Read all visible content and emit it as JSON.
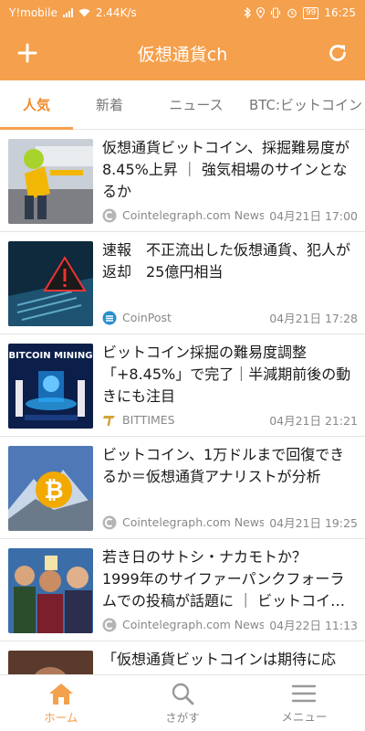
{
  "status_bar": {
    "carrier": "Y!mobile",
    "speed": "2.44K/s",
    "battery": "99",
    "time": "16:25"
  },
  "app_bar": {
    "title": "仮想通貨ch",
    "left_icon": "plus-icon",
    "right_icon": "refresh-icon"
  },
  "tabs": [
    {
      "label": "人気",
      "active": true
    },
    {
      "label": "新着",
      "active": false
    },
    {
      "label": "ニュース",
      "active": false
    },
    {
      "label": "BTC:ビットコイン",
      "active": false
    }
  ],
  "articles": [
    {
      "title": "仮想通貨ビットコイン、採掘難易度が8.45%上昇 ｜ 強気相場のサインとなるか",
      "source": "Cointelegraph.com News",
      "date": "04月21日 17:00",
      "source_icon": "cointelegraph-icon"
    },
    {
      "title": "速報　不正流出した仮想通貨、犯人が返却　25億円相当",
      "source": "CoinPost",
      "date": "04月21日 17:28",
      "source_icon": "coinpost-icon"
    },
    {
      "title": "ビットコイン採掘の難易度調整「+8.45%」で完了｜半減期前後の動きにも注目",
      "source": "BITTIMES",
      "date": "04月21日 21:21",
      "source_icon": "bittimes-icon",
      "thumb_text": "BITCOIN MINING"
    },
    {
      "title": "ビットコイン、1万ドルまで回復できるか＝仮想通貨アナリストが分析",
      "source": "Cointelegraph.com News",
      "date": "04月21日 19:25",
      "source_icon": "cointelegraph-icon"
    },
    {
      "title": "若き日のサトシ・ナカモトか？　1999年のサイファーパンクフォーラムでの投稿が話題に ｜ ビットコイ…",
      "source": "Cointelegraph.com News",
      "date": "04月22日 11:13",
      "source_icon": "cointelegraph-icon"
    },
    {
      "title": "「仮想通貨ビットコインは期待に応",
      "source": "",
      "date": "",
      "source_icon": ""
    }
  ],
  "bottom_nav": [
    {
      "label": "ホーム",
      "icon": "home-icon",
      "active": true
    },
    {
      "label": "さがす",
      "icon": "search-icon",
      "active": false
    },
    {
      "label": "メニュー",
      "icon": "menu-icon",
      "active": false
    }
  ],
  "colors": {
    "accent": "#f5a04c",
    "active_text": "#f08a2a",
    "meta_text": "#888888"
  }
}
